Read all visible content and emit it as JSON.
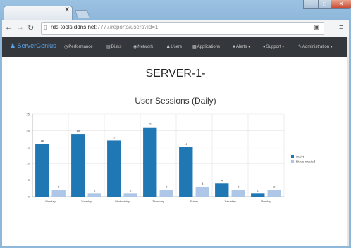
{
  "browser": {
    "tab_title": "",
    "url_host": "rds-tools.ddns.net",
    "url_path": ":7777/reports/users?id=1",
    "window_controls": {
      "minimize": "—",
      "maximize": "□",
      "close": "✕"
    }
  },
  "navbar": {
    "brand": "ServerGenius",
    "items": [
      {
        "label": "Performance",
        "icon": "clock-icon"
      },
      {
        "label": "Disks",
        "icon": "disk-icon"
      },
      {
        "label": "Network",
        "icon": "globe-icon"
      },
      {
        "label": "Users",
        "icon": "user-icon"
      },
      {
        "label": "Applications",
        "icon": "grid-icon"
      },
      {
        "label": "Alerts",
        "icon": "bell-icon"
      },
      {
        "label": "Support",
        "icon": "question-icon"
      },
      {
        "label": "Administration",
        "icon": "wrench-icon"
      }
    ]
  },
  "page": {
    "server_name": "SERVER-1-"
  },
  "chart_data": {
    "type": "bar",
    "title": "User Sessions (Daily)",
    "categories": [
      "Monday",
      "Tuesday",
      "Wednesday",
      "Thursday",
      "Friday",
      "Saturday",
      "Sunday"
    ],
    "series": [
      {
        "name": "Active",
        "values": [
          16,
          19,
          17,
          21,
          15,
          4,
          1
        ],
        "color": "#1f77b4"
      },
      {
        "name": "Disconnected",
        "values": [
          2,
          1,
          1,
          2,
          3,
          2,
          2
        ],
        "color": "#aec7e8"
      }
    ],
    "ylim": [
      0,
      25
    ],
    "yticks": [
      0,
      5,
      10,
      15,
      20,
      25
    ],
    "grid": true,
    "legend": "right"
  }
}
